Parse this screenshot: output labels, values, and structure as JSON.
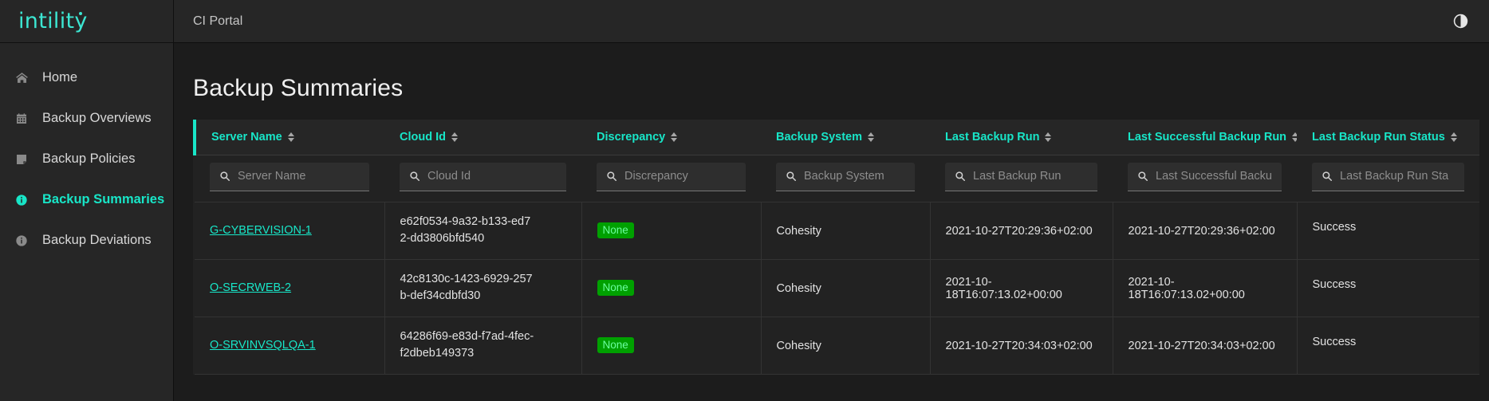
{
  "brand": {
    "logo_text": "intility",
    "accent_color": "#18e6c8"
  },
  "topbar": {
    "title": "CI Portal",
    "contrast_toggle_name": "contrast-toggle-icon"
  },
  "sidebar": {
    "items": [
      {
        "label": "Home",
        "icon": "home-icon",
        "active": false
      },
      {
        "label": "Backup Overviews",
        "icon": "calendar-icon",
        "active": false
      },
      {
        "label": "Backup Policies",
        "icon": "document-icon",
        "active": false
      },
      {
        "label": "Backup Summaries",
        "icon": "info-circle-icon",
        "active": true
      },
      {
        "label": "Backup Deviations",
        "icon": "info-circle-icon",
        "active": false
      }
    ]
  },
  "page": {
    "title": "Backup Summaries"
  },
  "table": {
    "columns": [
      {
        "label": "Server Name",
        "filter_placeholder": "Server Name"
      },
      {
        "label": "Cloud Id",
        "filter_placeholder": "Cloud Id"
      },
      {
        "label": "Discrepancy",
        "filter_placeholder": "Discrepancy"
      },
      {
        "label": "Backup System",
        "filter_placeholder": "Backup System"
      },
      {
        "label": "Last Backup Run",
        "filter_placeholder": "Last Backup Run"
      },
      {
        "label": "Last Successful Backup Run",
        "filter_placeholder": "Last Successful Backu"
      },
      {
        "label": "Last Backup Run Status",
        "filter_placeholder": "Last Backup Run Sta"
      }
    ],
    "filter_values": [
      "",
      "",
      "",
      "",
      "",
      "",
      ""
    ],
    "rows": [
      {
        "server_name": "G-CYBERVISION-1",
        "cloud_id": "e62f0534-9a32-b133-ed72-dd3806bfd540",
        "discrepancy": "None",
        "backup_system": "Cohesity",
        "last_backup_run": "2021-10-27T20:29:36+02:00",
        "last_successful_backup_run": "2021-10-27T20:29:36+02:00",
        "last_backup_run_status": "Success"
      },
      {
        "server_name": "O-SECRWEB-2",
        "cloud_id": "42c8130c-1423-6929-257b-def34cdbfd30",
        "discrepancy": "None",
        "backup_system": "Cohesity",
        "last_backup_run": "2021-10-18T16:07:13.02+00:00",
        "last_successful_backup_run": "2021-10-18T16:07:13.02+00:00",
        "last_backup_run_status": "Success"
      },
      {
        "server_name": "O-SRVINVSQLQA-1",
        "cloud_id": "64286f69-e83d-f7ad-4fec-f2dbeb149373",
        "discrepancy": "None",
        "backup_system": "Cohesity",
        "last_backup_run": "2021-10-27T20:34:03+02:00",
        "last_successful_backup_run": "2021-10-27T20:34:03+02:00",
        "last_backup_run_status": "Success"
      }
    ],
    "discrepancy_badge_color": "#00a000"
  }
}
